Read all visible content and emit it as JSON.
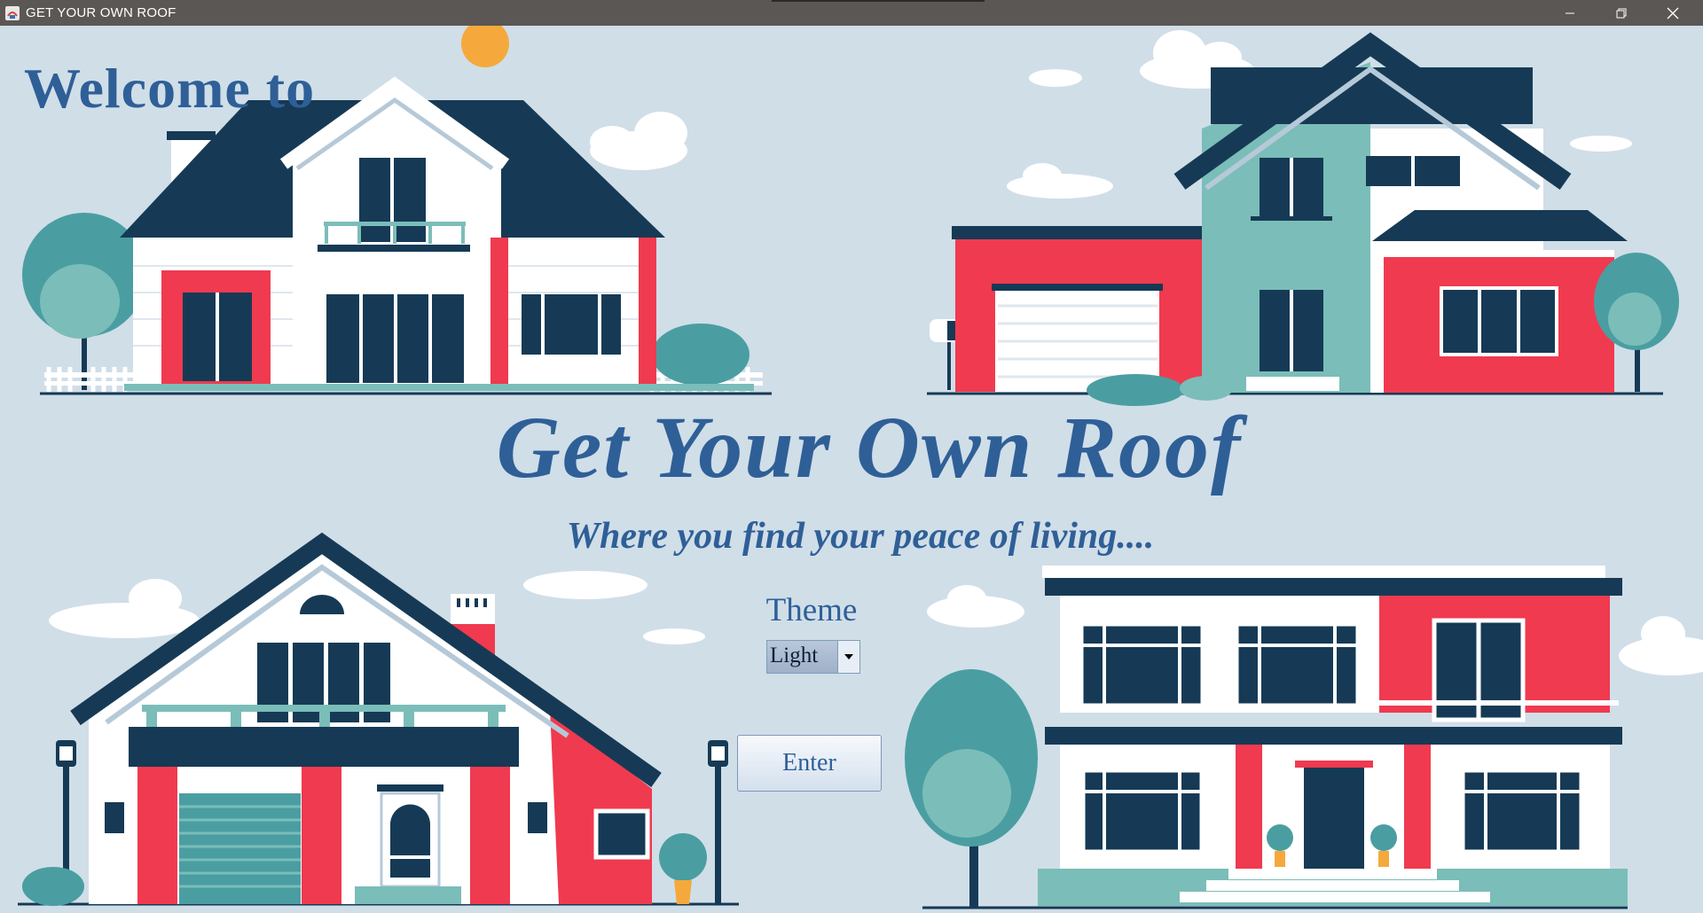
{
  "window": {
    "title": "GET YOUR OWN ROOF",
    "controls": {
      "minimize": "minimize",
      "maximize": "restore",
      "close": "close"
    }
  },
  "welcome_text": "Welcome to",
  "main_title": "Get Your Own Roof",
  "tagline": "Where you find your peace of living....",
  "theme": {
    "label": "Theme",
    "selected": "Light"
  },
  "enter_label": "Enter",
  "colors": {
    "background": "#d0dee8",
    "title_blue": "#2f5f97",
    "roof_navy": "#163a55",
    "accent_red": "#f03a4f",
    "teal": "#7bbdb9",
    "sun": "#f5a93c"
  },
  "icons": [
    "app-icon",
    "minimize-icon",
    "restore-icon",
    "close-icon",
    "dropdown-arrow-icon"
  ]
}
